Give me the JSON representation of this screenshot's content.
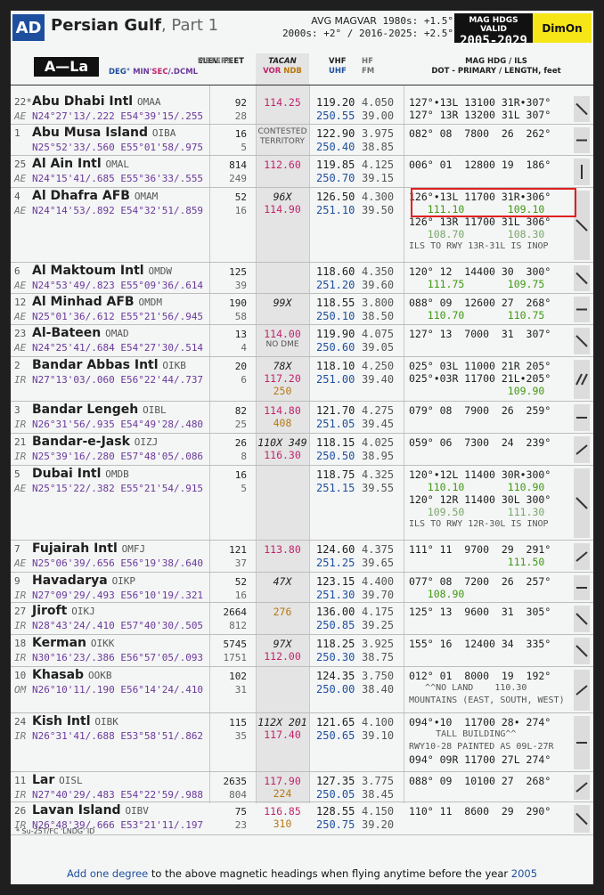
{
  "header": {
    "badge": "AD",
    "title": "Persian Gulf",
    "part": ", Part 1",
    "magvar_label": "AVG MAGVAR",
    "magvar_line1": "1980s: +1.5°",
    "magvar_line2": "2000s: +2° / 2016-2025: +2.5°",
    "valid_label": "MAG HDGS VALID",
    "valid_years": "2005-2029",
    "dim_label": "DimOn"
  },
  "columns": {
    "range": "A—La",
    "coords_label_deg": "DEG°",
    "coords_label_min": "MIN'",
    "coords_label_sec": "SEC",
    "coords_label_dcml": "/.DCML",
    "elev_label": "ELEV. FEET",
    "elev_meters": "METERS",
    "tacan": "TACAN",
    "vor": "VOR",
    "ndb": "NDB",
    "vhf": "VHF",
    "uhf": "UHF",
    "hf": "HF",
    "fm": "FM",
    "hdg_label": "MAG HDG / ILS",
    "hdg_sub": "DOT - PRIMARY / LENGTH, feet"
  },
  "rows": [
    {
      "num": "22*",
      "cc": "AE",
      "name": "Abu Dhabi Intl",
      "icao": "OMAA",
      "lat": "N24°27'13/.222",
      "lon": "E54°39'15/.255",
      "ft": "92",
      "m": "28",
      "tac": [
        "114.25"
      ],
      "vhf": "119.20",
      "uhf": "250.55",
      "hf": "4.050",
      "fm": "39.00",
      "hdg": [
        "127°•13L 13100 31R•307°",
        "127° 13R 13200 31L 307°"
      ]
    },
    {
      "num": "1",
      "cc": "",
      "name": "Abu Musa Island",
      "icao": "OIBA",
      "lat": "N25°52'33/.560",
      "lon": "E55°01'58/.975",
      "ft": "16",
      "m": "5",
      "tac": [
        "CONTESTED",
        "TERRITORY"
      ],
      "vhf": "122.90",
      "uhf": "250.40",
      "hf": "3.975",
      "fm": "38.85",
      "hdg": [
        "082° 08  7800  26  262°"
      ]
    },
    {
      "num": "25",
      "cc": "AE",
      "name": "Al Ain Intl",
      "icao": "OMAL",
      "lat": "N24°15'41/.685",
      "lon": "E55°36'33/.555",
      "ft": "814",
      "m": "249",
      "tac": [
        "112.60"
      ],
      "vhf": "119.85",
      "uhf": "250.70",
      "hf": "4.125",
      "fm": "39.15",
      "hdg": [
        "006° 01  12800 19  186°"
      ]
    },
    {
      "num": "4",
      "cc": "AE",
      "name": "Al Dhafra AFB",
      "icao": "OMAM",
      "lat": "N24°14'53/.892",
      "lon": "E54°32'51/.859",
      "ft": "52",
      "m": "16",
      "tac": [
        "96X",
        "114.90"
      ],
      "vhf": "126.50",
      "uhf": "251.10",
      "hf": "4.300",
      "fm": "39.50",
      "hdg": [
        "126°•13L 11700 31R•306°",
        "   111.10       109.10",
        "126° 13R 11700 31L 306°",
        "   108.70       108.30",
        "ILS TO RWY 13R-31L IS INOP"
      ]
    },
    {
      "num": "6",
      "cc": "AE",
      "name": "Al Maktoum Intl",
      "icao": "OMDW",
      "lat": "N24°53'49/.823",
      "lon": "E55°09'36/.614",
      "ft": "125",
      "m": "39",
      "tac": [],
      "vhf": "118.60",
      "uhf": "251.20",
      "hf": "4.350",
      "fm": "39.60",
      "hdg": [
        "120° 12  14400 30  300°",
        "   111.75       109.75"
      ]
    },
    {
      "num": "12",
      "cc": "AE",
      "name": "Al Minhad AFB",
      "icao": "OMDM",
      "lat": "N25°01'36/.612",
      "lon": "E55°21'56/.945",
      "ft": "190",
      "m": "58",
      "tac": [
        "99X"
      ],
      "vhf": "118.55",
      "uhf": "250.10",
      "hf": "3.800",
      "fm": "38.50",
      "hdg": [
        "088° 09  12600 27  268°",
        "   110.70       110.75"
      ]
    },
    {
      "num": "23",
      "cc": "AE",
      "name": "Al-Bateen",
      "icao": "OMAD",
      "lat": "N24°25'41/.684",
      "lon": "E54°27'30/.514",
      "ft": "13",
      "m": "4",
      "tac": [
        "114.00",
        "NO DME"
      ],
      "vhf": "119.90",
      "uhf": "250.60",
      "hf": "4.075",
      "fm": "39.05",
      "hdg": [
        "127° 13  7000  31  307°"
      ]
    },
    {
      "num": "2",
      "cc": "IR",
      "name": "Bandar Abbas Intl",
      "icao": "OIKB",
      "lat": "N27°13'03/.060",
      "lon": "E56°22'44/.737",
      "ft": "20",
      "m": "6",
      "tac": [
        "78X",
        "117.20",
        "250"
      ],
      "vhf": "118.10",
      "uhf": "251.00",
      "hf": "4.250",
      "fm": "39.40",
      "hdg": [
        "025° 03L 11000 21R 205°",
        "025°•03R 11700 21L•205°",
        "                109.90"
      ]
    },
    {
      "num": "3",
      "cc": "IR",
      "name": "Bandar Lengeh",
      "icao": "OIBL",
      "lat": "N26°31'56/.935",
      "lon": "E54°49'28/.480",
      "ft": "82",
      "m": "25",
      "tac": [
        "114.80",
        "408"
      ],
      "vhf": "121.70",
      "uhf": "251.05",
      "hf": "4.275",
      "fm": "39.45",
      "hdg": [
        "079° 08  7900  26  259°"
      ]
    },
    {
      "num": "21",
      "cc": "IR",
      "name": "Bandar-e-Jask",
      "icao": "OIZJ",
      "lat": "N25°39'16/.280",
      "lon": "E57°48'05/.086",
      "ft": "26",
      "m": "8",
      "tac": [
        "110X 349",
        "116.30"
      ],
      "vhf": "118.15",
      "uhf": "250.50",
      "hf": "4.025",
      "fm": "38.95",
      "hdg": [
        "059° 06  7300  24  239°"
      ]
    },
    {
      "num": "5",
      "cc": "AE",
      "name": "Dubai Intl",
      "icao": "OMDB",
      "lat": "N25°15'22/.382",
      "lon": "E55°21'54/.915",
      "ft": "16",
      "m": "5",
      "tac": [],
      "vhf": "118.75",
      "uhf": "251.15",
      "hf": "4.325",
      "fm": "39.55",
      "hdg": [
        "120°•12L 11400 30R•300°",
        "   110.10       110.90",
        "120° 12R 11400 30L 300°",
        "   109.50       111.30",
        "ILS TO RWY 12R-30L IS INOP"
      ]
    },
    {
      "num": "7",
      "cc": "AE",
      "name": "Fujairah Intl",
      "icao": "OMFJ",
      "lat": "N25°06'39/.656",
      "lon": "E56°19'38/.640",
      "ft": "121",
      "m": "37",
      "tac": [
        "113.80"
      ],
      "vhf": "124.60",
      "uhf": "251.25",
      "hf": "4.375",
      "fm": "39.65",
      "hdg": [
        "111° 11  9700  29  291°",
        "                111.50"
      ]
    },
    {
      "num": "9",
      "cc": "IR",
      "name": "Havadarya",
      "icao": "OIKP",
      "lat": "N27°09'29/.493",
      "lon": "E56°10'19/.321",
      "ft": "52",
      "m": "16",
      "tac": [
        "47X"
      ],
      "vhf": "123.15",
      "uhf": "251.30",
      "hf": "4.400",
      "fm": "39.70",
      "hdg": [
        "077° 08  7200  26  257°",
        "   108.90"
      ]
    },
    {
      "num": "27",
      "cc": "IR",
      "name": "Jiroft",
      "icao": "OIKJ",
      "lat": "N28°43'24/.410",
      "lon": "E57°40'30/.505",
      "ft": "2664",
      "m": "812",
      "tac": [
        "276"
      ],
      "vhf": "136.00",
      "uhf": "250.85",
      "hf": "4.175",
      "fm": "39.25",
      "hdg": [
        "125° 13  9600  31  305°"
      ]
    },
    {
      "num": "18",
      "cc": "IR",
      "name": "Kerman",
      "icao": "OIKK",
      "lat": "N30°16'23/.386",
      "lon": "E56°57'05/.093",
      "ft": "5745",
      "m": "1751",
      "tac": [
        "97X",
        "112.00"
      ],
      "vhf": "118.25",
      "uhf": "250.30",
      "hf": "3.925",
      "fm": "38.75",
      "hdg": [
        "155° 16  12400 34  335°"
      ]
    },
    {
      "num": "10",
      "cc": "OM",
      "name": "Khasab",
      "icao": "OOKB",
      "lat": "N26°10'11/.190",
      "lon": "E56°14'24/.410",
      "ft": "102",
      "m": "31",
      "tac": [],
      "vhf": "124.35",
      "uhf": "250.00",
      "hf": "3.750",
      "fm": "38.40",
      "hdg": [
        "012° 01  8000  19  192°",
        "   ^^NO LAND    110.30",
        "MOUNTAINS (EAST, SOUTH, WEST)"
      ]
    },
    {
      "num": "24",
      "cc": "IR",
      "name": "Kish Intl",
      "icao": "OIBK",
      "lat": "N26°31'41/.688",
      "lon": "E53°58'51/.862",
      "ft": "115",
      "m": "35",
      "tac": [
        "112X 201",
        "117.40"
      ],
      "vhf": "121.65",
      "uhf": "250.65",
      "hf": "4.100",
      "fm": "39.10",
      "hdg": [
        "094°•10  11700 28• 274°",
        "     TALL BUILDING^^",
        "RWY10-28 PAINTED AS 09L-27R",
        "094° 09R 11700 27L 274°"
      ]
    },
    {
      "num": "11",
      "cc": "IR",
      "name": "Lar",
      "icao": "OISL",
      "lat": "N27°40'29/.483",
      "lon": "E54°22'59/.988",
      "ft": "2635",
      "m": "804",
      "tac": [
        "117.90",
        "224"
      ],
      "vhf": "127.35",
      "uhf": "250.05",
      "hf": "3.775",
      "fm": "38.45",
      "hdg": [
        "088° 09  10100 27  268°"
      ]
    },
    {
      "num": "26",
      "cc": "IR",
      "name": "Lavan Island",
      "icao": "OIBV",
      "lat": "N26°48'39/.666",
      "lon": "E53°21'11/.197",
      "ft": "75",
      "m": "23",
      "tac": [
        "116.85",
        "310"
      ],
      "vhf": "128.55",
      "uhf": "250.75",
      "hf": "4.150",
      "fm": "39.20",
      "hdg": [
        "110° 11  8600  29  290°"
      ]
    }
  ],
  "footnote": "* Su-25T/FC 'LNDG' ID",
  "footer": {
    "a": "Add one degree",
    "b": " to the above magnetic headings when flying anytime before the year ",
    "c": "2005"
  }
}
